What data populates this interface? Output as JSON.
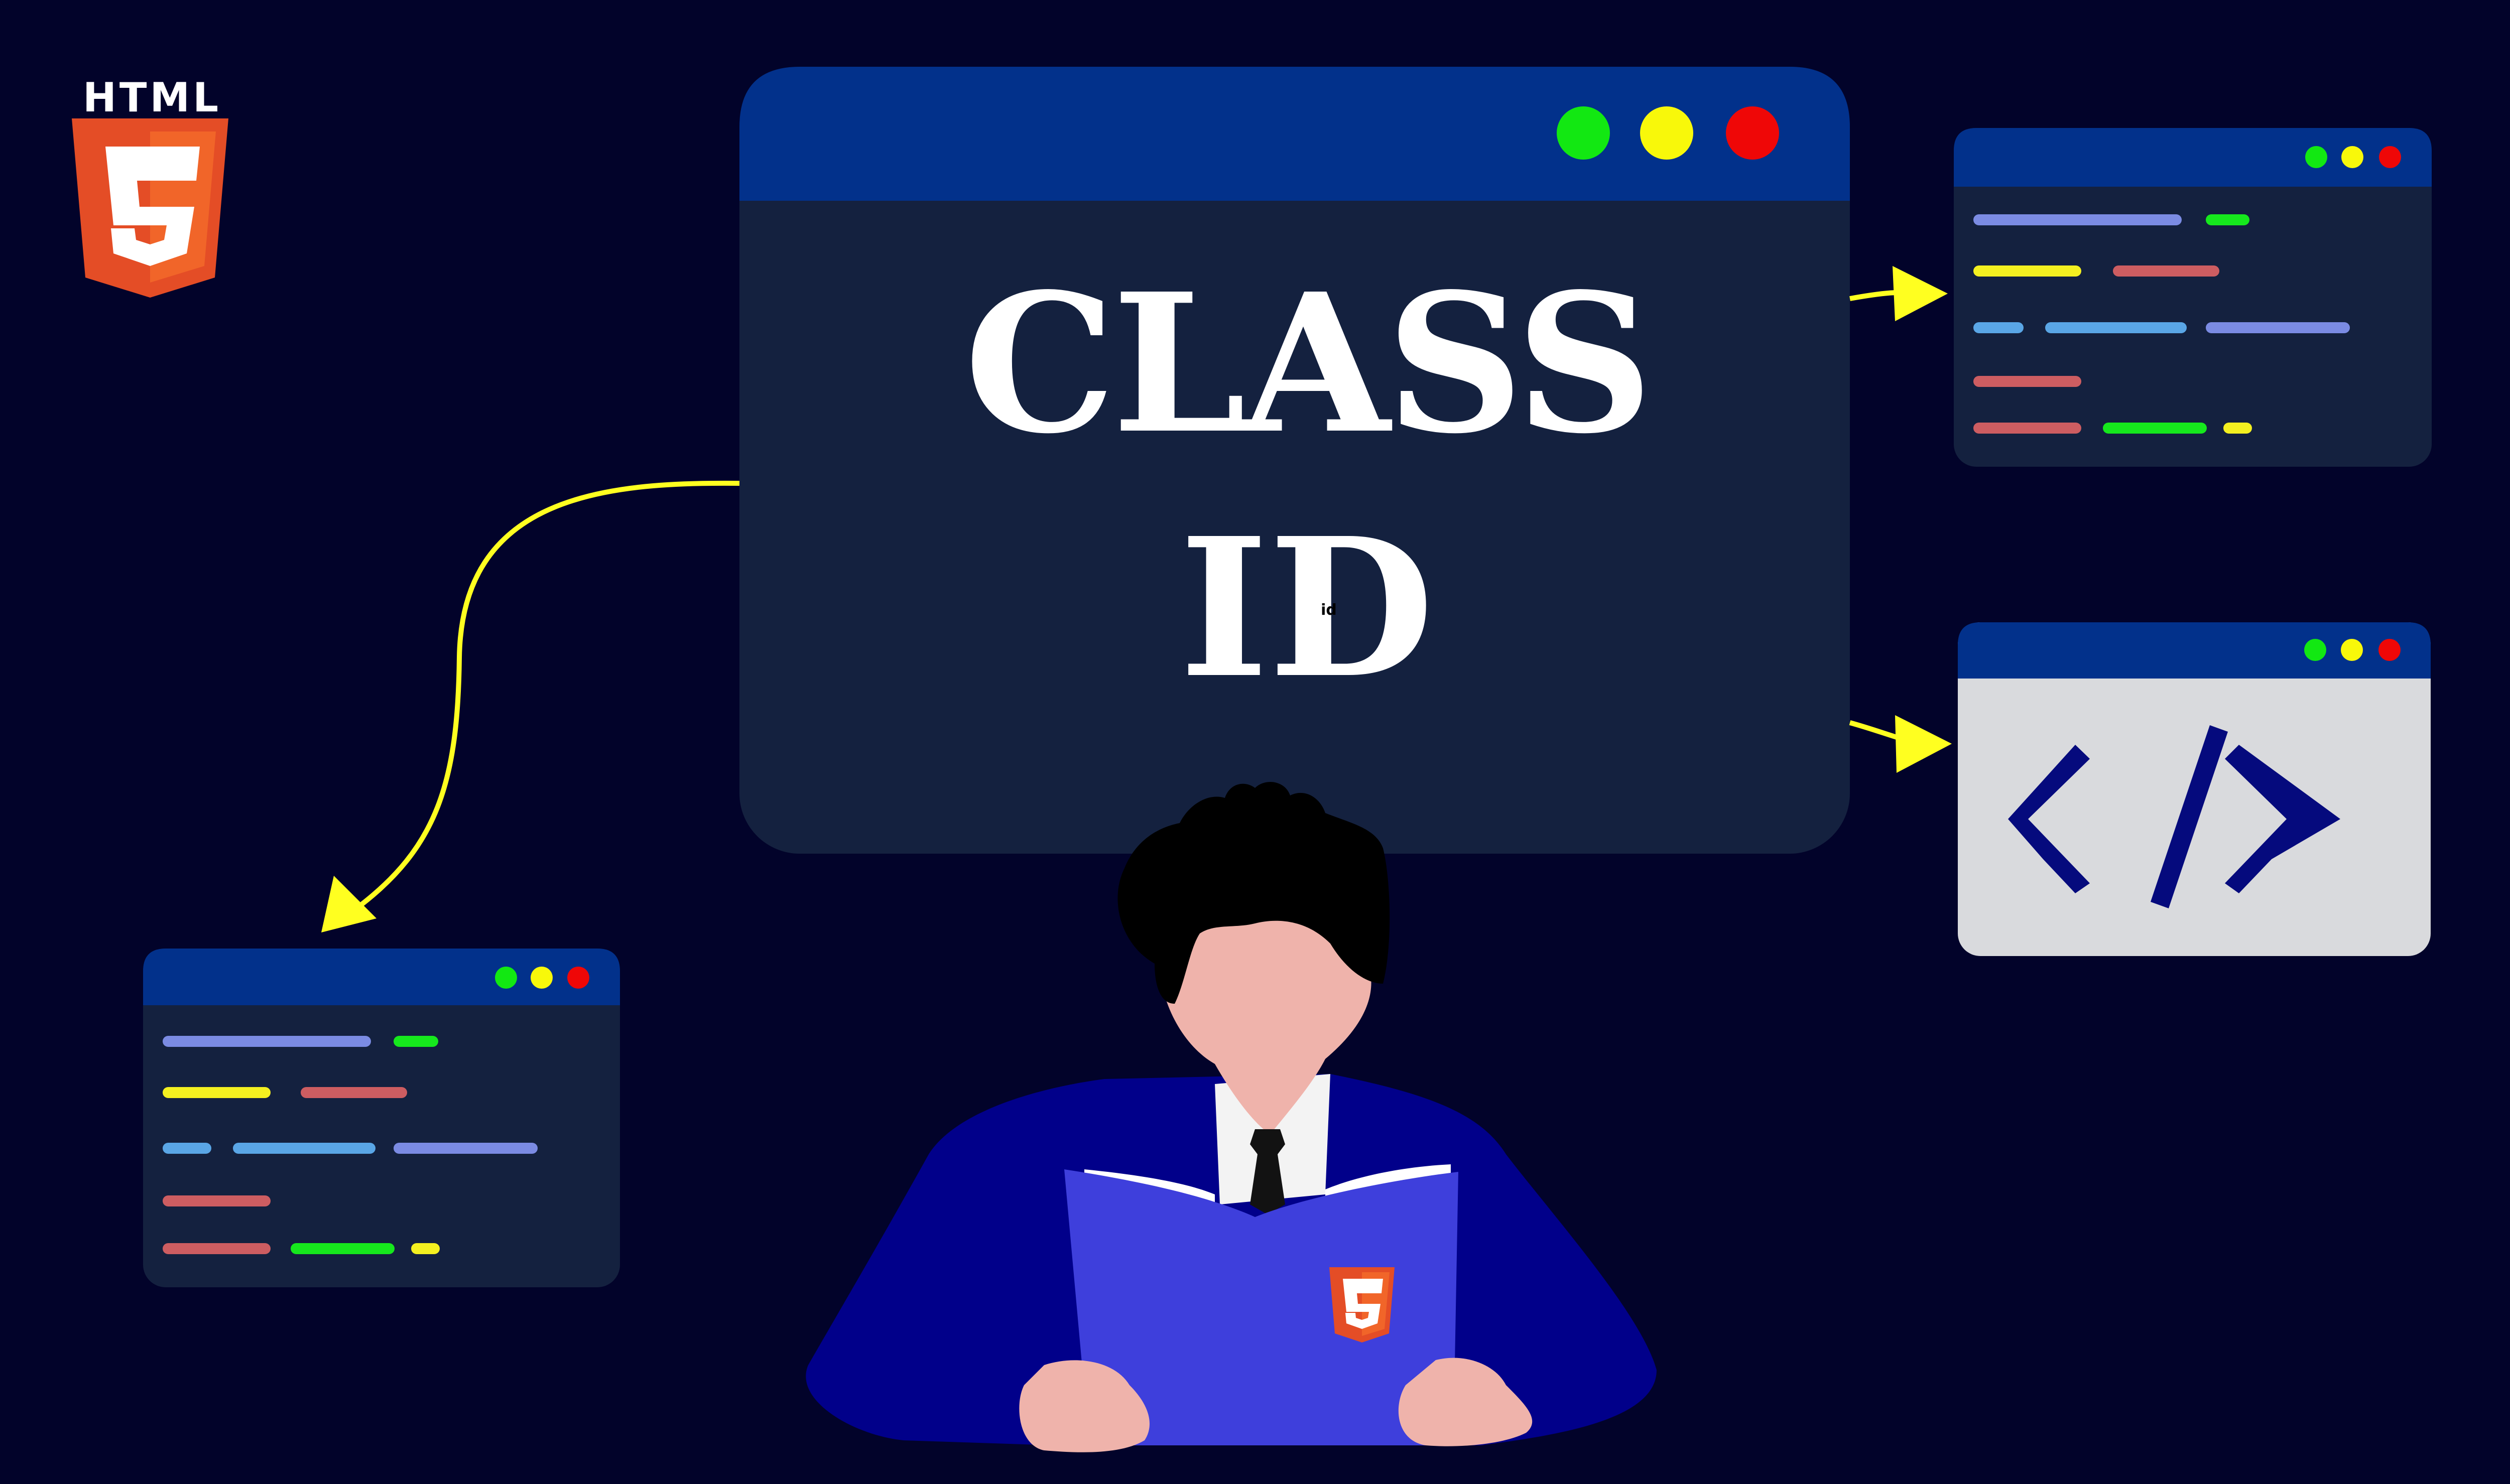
{
  "logo": {
    "text": "HTML",
    "icon": "html5-shield-icon",
    "brand_color": "#f06529"
  },
  "main_window": {
    "title_class": "CLASS",
    "title_id": "ID",
    "tiny_label": "id",
    "header_color": "#02318b",
    "body_color": "#14213f",
    "buttons": [
      "green-dot",
      "yellow-dot",
      "red-dot"
    ]
  },
  "colors": {
    "background": "#02032a",
    "arrow": "#ffff20",
    "dot_green": "#12e812",
    "dot_yellow": "#f8f80a",
    "dot_red": "#ef0707",
    "code_tag_color": "#050a7d",
    "code_window_body": "#d9dadd"
  },
  "side_windows": [
    {
      "name": "code-window-top-right",
      "kind": "code-lines"
    },
    {
      "name": "code-window-bottom-right",
      "kind": "code-tag",
      "icon": "code-tag-icon"
    },
    {
      "name": "code-window-left",
      "kind": "code-lines"
    }
  ],
  "character": {
    "icon": "person-reading-book-illustration",
    "book_badge": "html5-shield-icon"
  }
}
